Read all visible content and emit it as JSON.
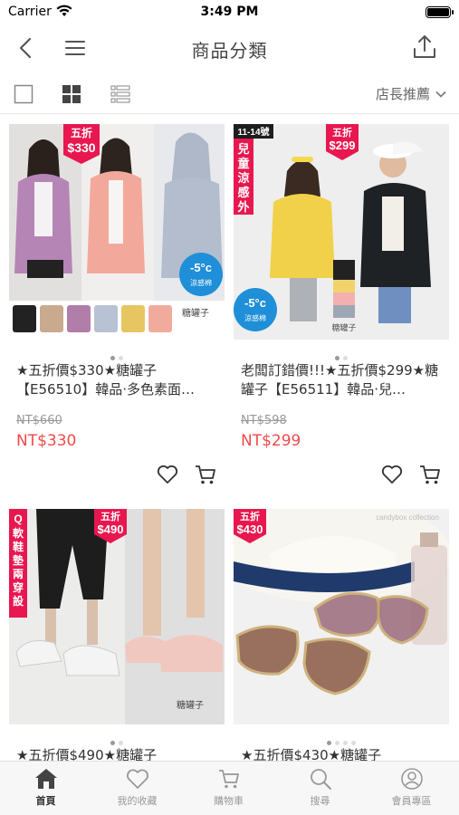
{
  "status": {
    "carrier": "Carrier",
    "time": "3:49 PM"
  },
  "nav": {
    "title": "商品分類"
  },
  "toolbar": {
    "sort_label": "店長推薦"
  },
  "products": [
    {
      "name": "★五折價$330★糖罐子【E56510】韓品‧多色素面…",
      "old_price": "NT$660",
      "price": "NT$330",
      "badge_top": "五折",
      "badge_price": "$330",
      "cool_tag": "-5°C 涼感棉",
      "brand": "糖罐子",
      "images": 2,
      "active_image": 0
    },
    {
      "name": "老闆訂錯價!!!★五折價$299★糖罐子【E56511】韓品‧兒…",
      "old_price": "NT$598",
      "price": "NT$299",
      "badge_top": "五折",
      "badge_price": "$299",
      "side_tag": "兒童涼感外套",
      "size_tag": "11-14號",
      "cool_tag": "-5°C 涼感棉",
      "brand": "糖罐子",
      "images": 2,
      "active_image": 0
    },
    {
      "name": "★五折價$490★糖罐子",
      "badge_top": "五折",
      "badge_price": "$490",
      "side_tag": "Q軟鞋墊‧兩穿設計",
      "brand": "糖罐子",
      "images": 2,
      "active_image": 0
    },
    {
      "name": "★五折價$430★糖罐子",
      "badge_top": "五折",
      "badge_price": "$430",
      "brand": "candybox collection",
      "images": 4,
      "active_image": 0
    }
  ],
  "tabs": [
    {
      "label": "首頁",
      "icon": "home-icon",
      "active": true
    },
    {
      "label": "我的收藏",
      "icon": "heart-icon",
      "active": false
    },
    {
      "label": "購物車",
      "icon": "cart-icon",
      "active": false
    },
    {
      "label": "搜尋",
      "icon": "search-icon",
      "active": false
    },
    {
      "label": "會員專區",
      "icon": "user-icon",
      "active": false
    }
  ],
  "colors": {
    "accent": "#f04a4a",
    "badge": "#e8174f",
    "tab_active": "#333333",
    "tab_inactive": "#999999"
  }
}
